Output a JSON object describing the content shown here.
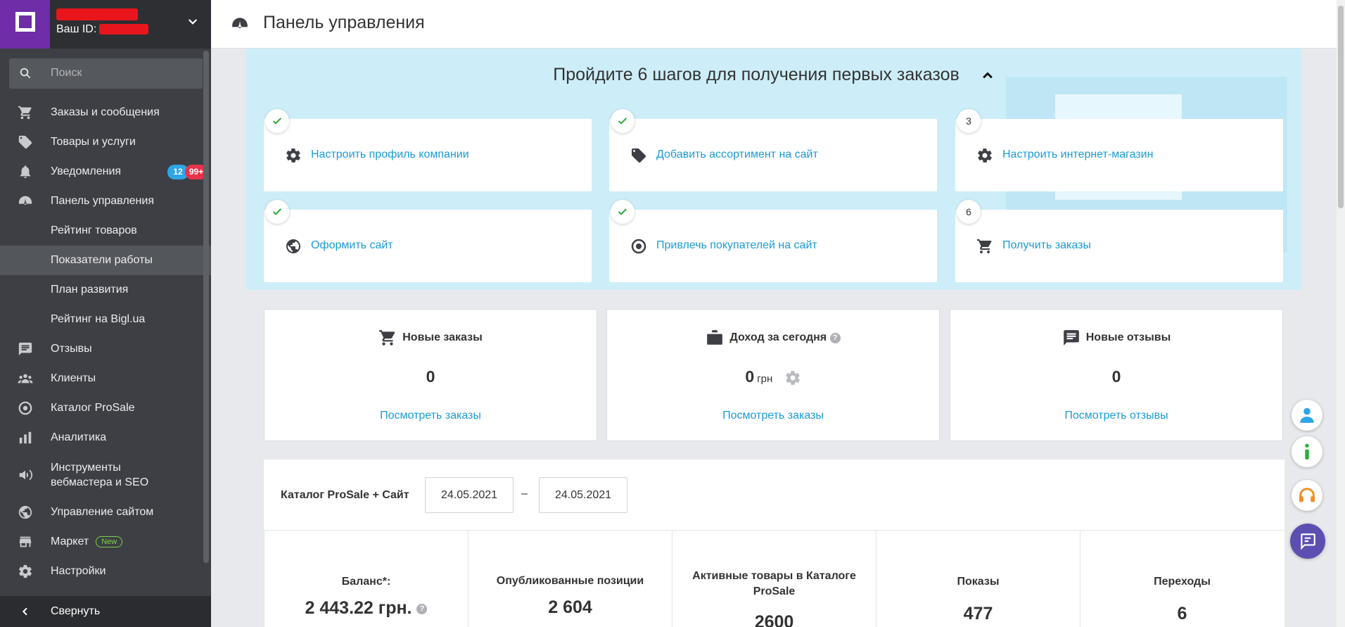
{
  "sidebar": {
    "id_label": "Ваш ID:",
    "search_placeholder": "Поиск",
    "items": [
      {
        "label": "Заказы и сообщения",
        "icon": "cart-icon"
      },
      {
        "label": "Товары и услуги",
        "icon": "tag-icon"
      },
      {
        "label": "Уведомления",
        "icon": "bell-icon",
        "badge_blue": "12",
        "badge_red": "99+"
      },
      {
        "label": "Панель управления",
        "icon": "dashboard-icon"
      },
      {
        "label": "Рейтинг товаров"
      },
      {
        "label": "Показатели работы"
      },
      {
        "label": "План развития"
      },
      {
        "label": "Рейтинг на Bigl.ua"
      },
      {
        "label": "Отзывы",
        "icon": "comment-icon"
      },
      {
        "label": "Клиенты",
        "icon": "people-icon"
      },
      {
        "label": "Каталог ProSale",
        "icon": "target-icon"
      },
      {
        "label": "Аналитика",
        "icon": "bar-chart-icon"
      },
      {
        "label_line1": "Инструменты",
        "label_line2": "вебмастера и SEO",
        "icon": "megaphone-icon"
      },
      {
        "label": "Управление сайтом",
        "icon": "globe-icon"
      },
      {
        "label": "Маркет",
        "icon": "store-icon",
        "new_badge": "New"
      },
      {
        "label": "Настройки",
        "icon": "gear-icon"
      }
    ],
    "collapse_label": "Свернуть"
  },
  "header": {
    "title": "Панель управления"
  },
  "steps": {
    "title": "Пройдите 6 шагов для получения первых заказов",
    "items": [
      {
        "label": "Настроить профиль компании",
        "marker": "done"
      },
      {
        "label": "Добавить ассортимент на сайт",
        "marker": "done"
      },
      {
        "label": "Настроить интернет-магазин",
        "marker": "3"
      },
      {
        "label": "Оформить сайт",
        "marker": "done"
      },
      {
        "label": "Привлечь покупателей на сайт",
        "marker": "done"
      },
      {
        "label": "Получить заказы",
        "marker": "6"
      }
    ]
  },
  "cards": [
    {
      "title": "Новые заказы",
      "value": "0",
      "link": "Посмотреть заказы"
    },
    {
      "title": "Доход за сегодня",
      "value": "0",
      "unit": "грн",
      "help": "?",
      "link": "Посмотреть заказы"
    },
    {
      "title": "Новые отзывы",
      "value": "0",
      "link": "Посмотреть отзывы"
    }
  ],
  "stats": {
    "filter_label": "Каталог ProSale + Сайт",
    "date_from": "24.05.2021",
    "date_sep": "–",
    "date_to": "24.05.2021",
    "columns": [
      {
        "label": "Баланс*:",
        "value": "2 443.22 грн.",
        "help": "?"
      },
      {
        "label": "Опубликованные позиции",
        "value": "2 604"
      },
      {
        "label_line1": "Активные товары в Каталоге",
        "label_line2": "ProSale",
        "value": "2600"
      },
      {
        "label": "Показы",
        "value": "477"
      },
      {
        "label": "Переходы",
        "value": "6"
      }
    ]
  },
  "colors": {
    "accent_link": "#1a9bd7",
    "brand_purple": "#6f2da8",
    "sidebar_bg": "#3d3f45",
    "badge_red": "#e8334a",
    "badge_blue": "#2ea6e6",
    "check_green": "#2eaa3c"
  }
}
